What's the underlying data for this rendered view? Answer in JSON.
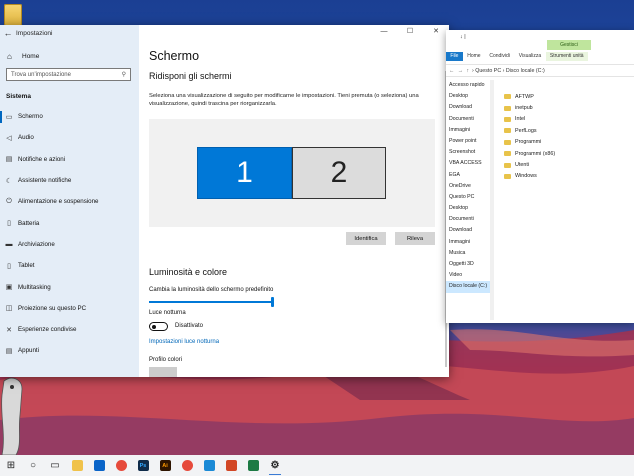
{
  "settings": {
    "window_title": "Impostazioni",
    "home_label": "Home",
    "search_placeholder": "Trova un'impostazione",
    "section_title": "Sistema",
    "nav_items": [
      {
        "label": "Schermo",
        "icon": "monitor-icon"
      },
      {
        "label": "Audio",
        "icon": "speaker-icon"
      },
      {
        "label": "Notifiche e azioni",
        "icon": "notifications-icon"
      },
      {
        "label": "Assistente notifiche",
        "icon": "moon-icon"
      },
      {
        "label": "Alimentazione e sospensione",
        "icon": "power-icon"
      },
      {
        "label": "Batteria",
        "icon": "battery-icon"
      },
      {
        "label": "Archiviazione",
        "icon": "storage-icon"
      },
      {
        "label": "Tablet",
        "icon": "tablet-icon"
      },
      {
        "label": "Multitasking",
        "icon": "multitasking-icon"
      },
      {
        "label": "Proiezione su questo PC",
        "icon": "projection-icon"
      },
      {
        "label": "Esperienze condivise",
        "icon": "shared-icon"
      },
      {
        "label": "Appunti",
        "icon": "clipboard-icon"
      }
    ],
    "selected_item": "Schermo",
    "page_title": "Schermo",
    "arrange_title": "Ridisponi gli schermi",
    "arrange_description": "Seleziona una visualizzazione di seguito per modificarne le impostazioni. Tieni premuta (o seleziona) una visualizzazione, quindi trascina per riorganizzarla.",
    "monitor_1": "1",
    "monitor_2": "2",
    "identify_button": "Identifica",
    "detect_button": "Rileva",
    "brightness_title": "Luminosità e colore",
    "brightness_label": "Cambia la luminosità dello schermo predefinito",
    "brightness_level": 1.0,
    "night_light_label": "Luce notturna",
    "night_light_state": "Disattivato",
    "night_light_link": "Impostazioni luce notturna",
    "color_profile_label": "Profilo colori"
  },
  "explorer": {
    "title": "↓ |",
    "contextual_tab": "Gestisci",
    "tabs": [
      "File",
      "Home",
      "Condividi",
      "Visualizza",
      "Strumenti unità"
    ],
    "path": "› Questo PC › Disco locale (C:)",
    "tree": [
      "Accesso rapido",
      "Desktop",
      "Download",
      "Documenti",
      "Immagini",
      "Power point",
      "Screenshot",
      "VBA ACCESS",
      "EGA",
      "OneDrive",
      "Questo PC",
      "Desktop",
      "Documenti",
      "Download",
      "Immagini",
      "Musica",
      "Oggetti 3D",
      "Video",
      "Disco locale (C:)"
    ],
    "selected_tree": "Disco locale (C:)",
    "items": [
      "AFTWP",
      "inetpub",
      "Intel",
      "PerfLogs",
      "Programmi",
      "Programmi (x86)",
      "Utenti",
      "Windows"
    ]
  },
  "taskbar": {
    "items": [
      {
        "icon": "start-icon"
      },
      {
        "icon": "search-icon"
      },
      {
        "icon": "task-view-icon"
      },
      {
        "icon": "file-explorer-icon"
      },
      {
        "icon": "outlook-icon"
      },
      {
        "icon": "chrome-icon"
      },
      {
        "icon": "photoshop-icon",
        "text": "Ps"
      },
      {
        "icon": "illustrator-icon",
        "text": "Ai"
      },
      {
        "icon": "chrome-icon"
      },
      {
        "icon": "edge-icon"
      },
      {
        "icon": "powerpoint-icon"
      },
      {
        "icon": "excel-icon"
      },
      {
        "icon": "settings-icon"
      }
    ]
  },
  "colors": {
    "accent": "#0078d7",
    "taskbar": "#f2f3f5",
    "sidebar": "#e2ecf6",
    "folder": "#e8c34a"
  }
}
